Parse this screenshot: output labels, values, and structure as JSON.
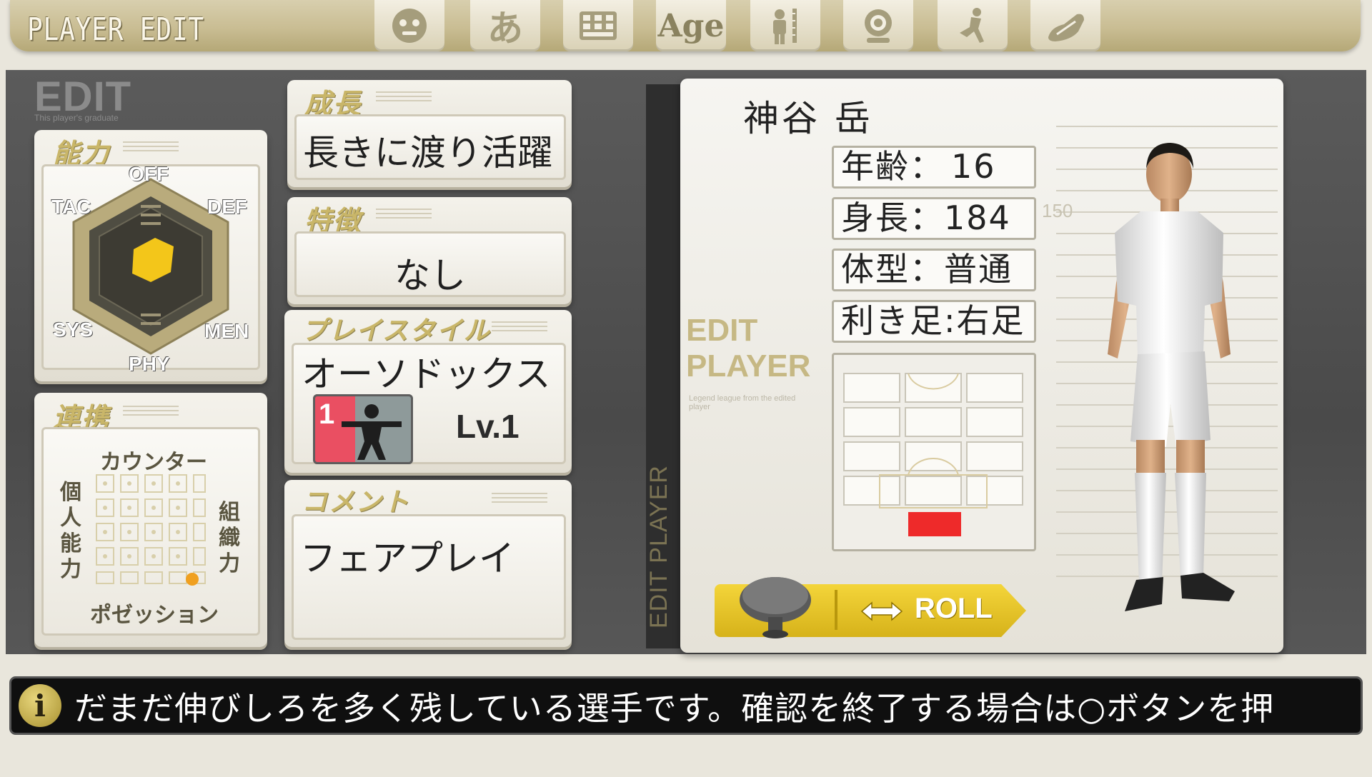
{
  "header": {
    "title": "PLAYER EDIT",
    "tabs": [
      {
        "icon": "face-icon"
      },
      {
        "icon": "name-icon",
        "label": "あ"
      },
      {
        "icon": "keyboard-icon"
      },
      {
        "label": "Age"
      },
      {
        "icon": "body-measure-icon"
      },
      {
        "icon": "webcam-icon"
      },
      {
        "icon": "kick-icon"
      },
      {
        "icon": "boot-icon"
      }
    ]
  },
  "left": {
    "logo": "EDIT",
    "logo_sub": "This player's graduate"
  },
  "ability": {
    "label": "能力",
    "axes": [
      "OFF",
      "DEF",
      "MEN",
      "PHY",
      "SYS",
      "TAC"
    ]
  },
  "link": {
    "label": "連携",
    "top": "カウンター",
    "bottom": "ポゼッション",
    "left": "個人能力",
    "right": "組織力"
  },
  "growth": {
    "label": "成長",
    "value": "長きに渡り活躍"
  },
  "traits": {
    "label": "特徴",
    "value": "なし"
  },
  "playstyle": {
    "label": "プレイスタイル",
    "value": "オーソドックス",
    "badge_num": "1",
    "level": "Lv.1"
  },
  "comment": {
    "label": "コメント",
    "value": "フェアプレイ"
  },
  "profile": {
    "name": "神谷 岳",
    "side_label_1": "EDIT",
    "side_label_2": "PLAYER",
    "side_small": "Legend league from the edited player",
    "stripe_text": "EDIT PLAYER",
    "stats": [
      {
        "label": "年齢",
        "value": "16"
      },
      {
        "label": "身長",
        "value": "184"
      },
      {
        "label": "体型",
        "value": "普通"
      },
      {
        "label": "利き足",
        "value": "右足"
      }
    ],
    "height_mark": "150",
    "position_color": "#ee2a2a",
    "roll": "ROLL"
  },
  "message": {
    "icon": "i",
    "text": "だまだ伸びしろを多く残している選手です。確認を終了する場合は○ボタンを押"
  },
  "colors": {
    "accent_gold": "#c9b669",
    "yellow": "#f4d53a",
    "orange": "#f0a020"
  }
}
